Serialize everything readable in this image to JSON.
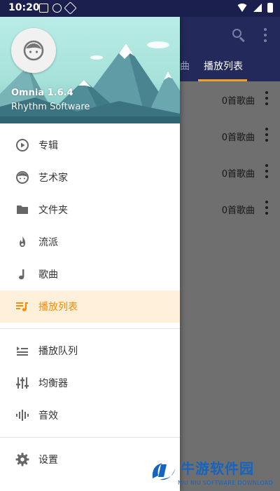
{
  "status_bar": {
    "time": "10:20"
  },
  "background_app": {
    "tabs": [
      {
        "label": "曲",
        "active": false
      },
      {
        "label": "播放列表",
        "active": true
      }
    ],
    "playlists": [
      {
        "count": "0首歌曲"
      },
      {
        "count": "0首歌曲"
      },
      {
        "count": "0首歌曲"
      },
      {
        "count": "0首歌曲"
      }
    ]
  },
  "drawer": {
    "header": {
      "app_name": "Omnia 1.6.4",
      "developer": "Rhythm Software"
    },
    "menu": [
      {
        "label": "专辑",
        "icon": "play-circle-icon",
        "active": false
      },
      {
        "label": "艺术家",
        "icon": "face-icon",
        "active": false
      },
      {
        "label": "文件夹",
        "icon": "folder-icon",
        "active": false
      },
      {
        "label": "流派",
        "icon": "flame-icon",
        "active": false
      },
      {
        "label": "歌曲",
        "icon": "music-note-icon",
        "active": false
      },
      {
        "label": "播放列表",
        "icon": "playlist-icon",
        "active": true
      }
    ],
    "menu2": [
      {
        "label": "播放队列",
        "icon": "queue-icon"
      },
      {
        "label": "均衡器",
        "icon": "equalizer-icon"
      },
      {
        "label": "音效",
        "icon": "sound-wave-icon"
      }
    ],
    "menu3": [
      {
        "label": "设置",
        "icon": "gear-icon"
      }
    ]
  },
  "watermark": {
    "title": "牛游软件园",
    "subtitle": "NIU NIU SOFTWARE DOWNLOAD"
  },
  "colors": {
    "accent": "#ff8a00",
    "toolbar": "#23295a",
    "active_bg": "#fff0dc"
  }
}
